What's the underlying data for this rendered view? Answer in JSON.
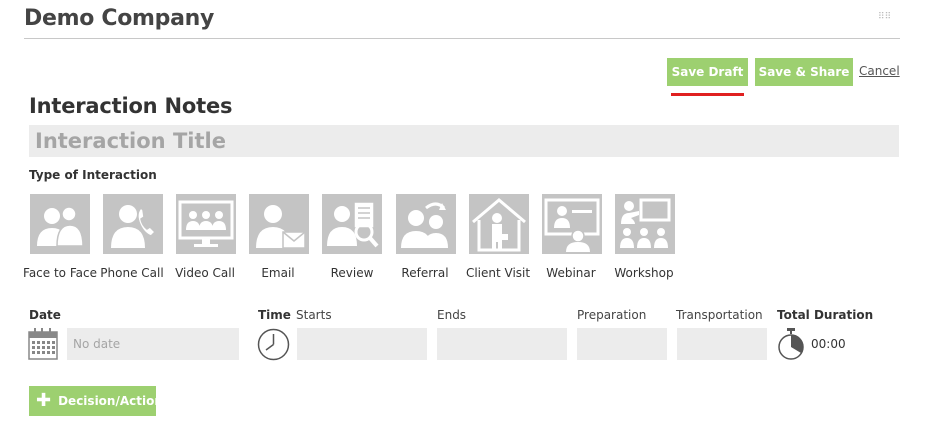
{
  "header": {
    "company": "Demo Company",
    "menu_glyph": "⠿⠿"
  },
  "toolbar": {
    "save_draft": "Save Draft",
    "save_share": "Save & Share",
    "cancel": "Cancel"
  },
  "form": {
    "section_title": "Interaction Notes",
    "title_placeholder": "Interaction Title",
    "type_label": "Type of Interaction",
    "types": [
      {
        "label": "Face to Face",
        "icon": "face-to-face-icon"
      },
      {
        "label": "Phone Call",
        "icon": "phone-call-icon"
      },
      {
        "label": "Video Call",
        "icon": "video-call-icon"
      },
      {
        "label": "Email",
        "icon": "email-icon"
      },
      {
        "label": "Review",
        "icon": "review-icon"
      },
      {
        "label": "Referral",
        "icon": "referral-icon"
      },
      {
        "label": "Client Visit",
        "icon": "client-visit-icon"
      },
      {
        "label": "Webinar",
        "icon": "webinar-icon"
      },
      {
        "label": "Workshop",
        "icon": "workshop-icon"
      }
    ],
    "date_label": "Date",
    "date_placeholder": "No date",
    "time_label": "Time",
    "starts_label": "Starts",
    "ends_label": "Ends",
    "preparation_label": "Preparation",
    "transportation_label": "Transportation",
    "total_duration_label": "Total Duration",
    "total_duration_value": "00:00",
    "decision_button": "Decision/Action"
  },
  "colors": {
    "accent_green": "#9dd070",
    "underline_red": "#e02020",
    "tile_gray": "#c4c4c4",
    "field_gray": "#ececec"
  }
}
